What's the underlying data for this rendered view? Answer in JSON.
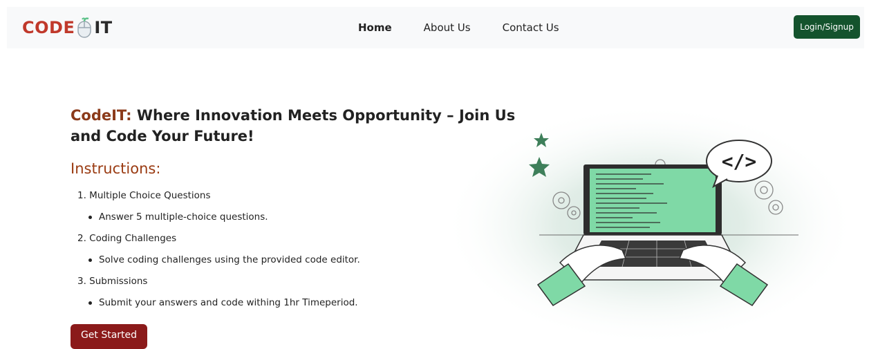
{
  "brand": {
    "logo_code": "CODE",
    "logo_it": "IT",
    "colors": {
      "code": "#c0392b",
      "accent": "#5ec28a",
      "dark": "#2a2a2a"
    }
  },
  "nav": {
    "links": [
      {
        "label": "Home",
        "active": true
      },
      {
        "label": "About Us",
        "active": false
      },
      {
        "label": "Contact Us",
        "active": false
      }
    ],
    "login_label": "Login/Signup"
  },
  "hero": {
    "brand_prefix": "CodeIT:",
    "title_rest": " Where Innovation Meets Opportunity – Join Us and Code Your Future!",
    "instructions_heading": "Instructions:",
    "steps": [
      {
        "title": "1. Multiple Choice Questions",
        "detail": "Answer 5 multiple-choice questions."
      },
      {
        "title": "2. Coding Challenges",
        "detail": "Solve coding challenges using the provided code editor."
      },
      {
        "title": "3. Submissions",
        "detail": "Submit your answers and code withing 1hr Timeperiod."
      }
    ],
    "cta_label": "Get Started"
  },
  "illustration": {
    "code_symbol": "</>",
    "icons": [
      "laptop-icon",
      "star-icon",
      "gear-icon",
      "code-bubble-icon",
      "hands-icon"
    ]
  }
}
